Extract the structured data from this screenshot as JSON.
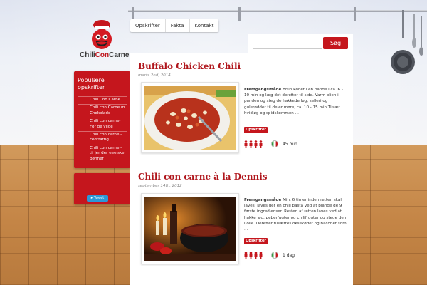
{
  "site": {
    "logo_text_1": "Chili",
    "logo_text_2": "Con",
    "logo_text_3": "Carne"
  },
  "nav": {
    "items": [
      "Opskrifter",
      "Fakta",
      "Kontakt"
    ]
  },
  "search": {
    "placeholder": "",
    "button_label": "Søg"
  },
  "sidebar": {
    "title": "Populære opskrifter",
    "links": [
      "Chili Con Carne",
      "Chili con Carne m. Chokolade",
      "Chili con carne- For de vilde",
      "Chili con carne - Fedtfattig",
      "Chili con carne - til jer der eeelsker bønner"
    ],
    "tweet_label": "Tweet"
  },
  "posts": [
    {
      "title": "Buffalo Chicken Chili",
      "date": "marts 2nd, 2014",
      "lead": "Fremgangsmåde",
      "text": " Brun kødet i en pande i ca. 6 - 10 min og læg det derefter til side. Varm olien i panden og steg de hakkede løg, selleri og gulerødder til de er møre, ca. 10 - 15 min Tilsæt hvidløg og spidskommen ...",
      "category": "Opskrifter",
      "heat": 4,
      "time": "45 min."
    },
    {
      "title": "Chili con carne à la Dennis",
      "date": "september 14th, 2012",
      "lead": "Fremgangsmåde",
      "text": " Min. 6 timer inden retten skal laves, laves der en chili pasta ved at blande de 9 første ingredienser. Resten af retten laves ved at hakke løg, peberfugter og chilifrugter og stege den i olie. Derefter tilsættes oksekødet og baconet som ...",
      "category": "Opskrifter",
      "heat": 4,
      "time": "1 dag"
    }
  ],
  "colors": {
    "brand_red": "#c5161d",
    "title_red": "#b0161c",
    "twitter_blue": "#2c97d7"
  },
  "icons": {
    "heat": "chili-person-icon",
    "flag": "italian-flag-badge-icon"
  }
}
